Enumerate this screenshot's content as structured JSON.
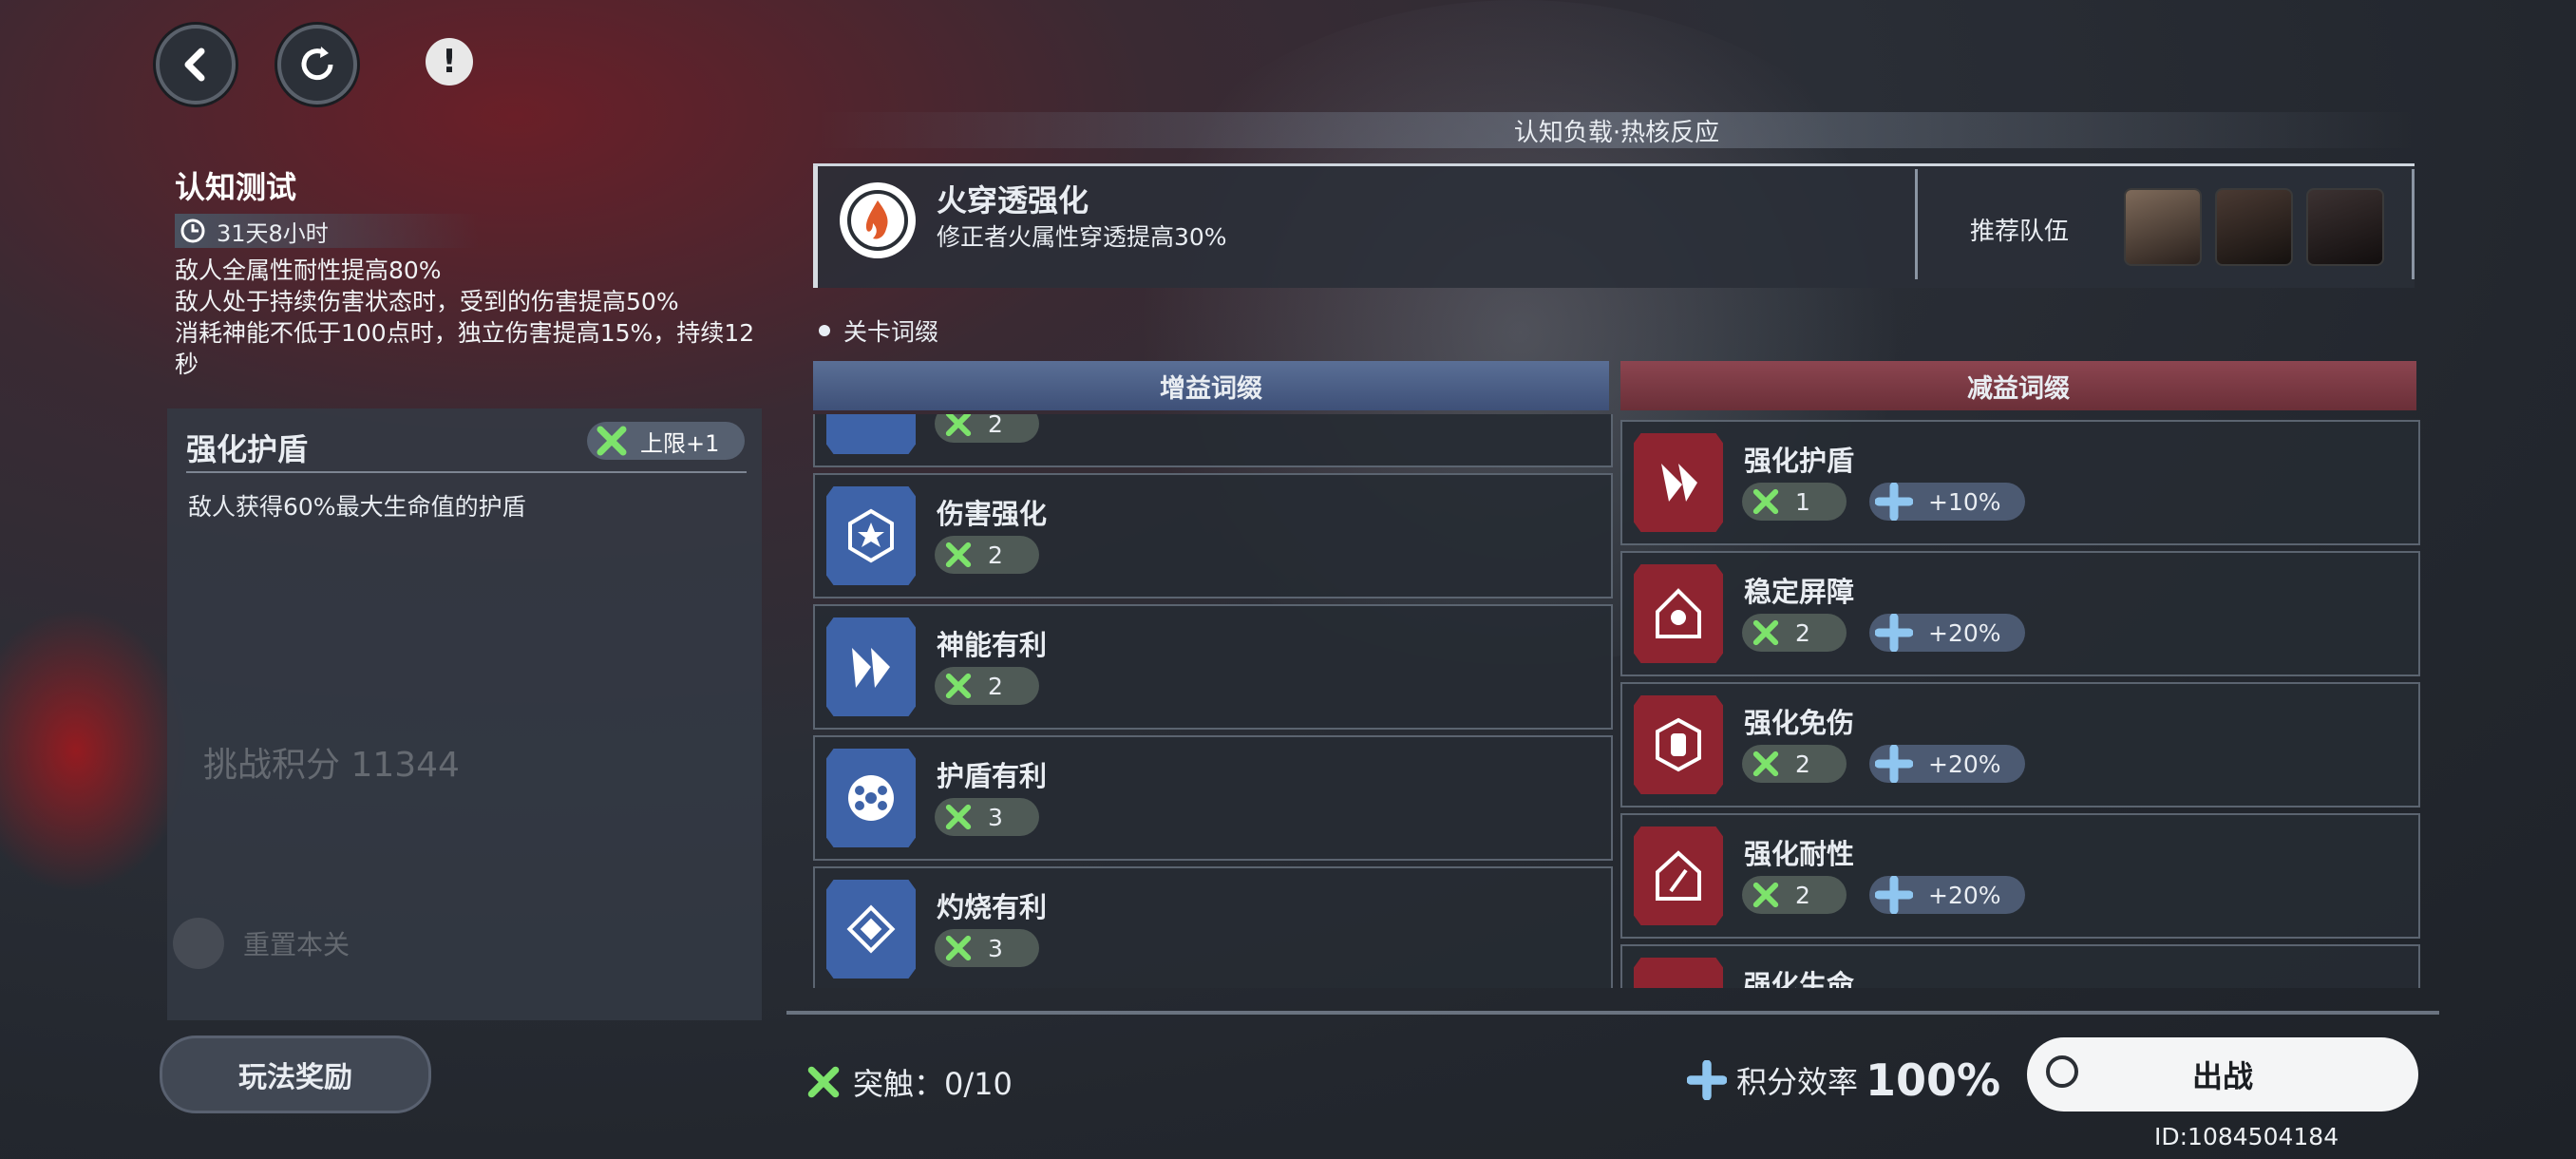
{
  "header": {
    "back_icon": "chevron-left-icon",
    "refresh_icon": "refresh-icon",
    "info_icon": "exclamation-icon",
    "info_mark": "!"
  },
  "stage": {
    "title": "认知测试",
    "time_left": "31天8小时",
    "descriptions": [
      "敌人全属性耐性提高80%",
      "敌人处于持续伤害状态时，受到的伤害提高50%",
      "消耗神能不低于100点时，独立伤害提高15%，持续12秒"
    ]
  },
  "selected_card": {
    "title": "强化护盾",
    "limit": "上限+1",
    "desc": "敌人获得60%最大生命值的护盾",
    "score_ghost": "挑战积分 11344",
    "reset_ghost": "重置本关"
  },
  "reward_button": "玩法奖励",
  "band_title": "认知负载·热核反应",
  "core_effect": {
    "title": "火穿透强化",
    "subtitle": "修正者火属性穿透提高30%"
  },
  "team": {
    "label": "推荐队伍"
  },
  "section_label": "关卡词缀",
  "buff_header": "增益词缀",
  "debuff_header": "减益词缀",
  "buffs": [
    {
      "name": "",
      "count": "2"
    },
    {
      "name": "伤害强化",
      "count": "2"
    },
    {
      "name": "神能有利",
      "count": "2"
    },
    {
      "name": "护盾有利",
      "count": "3"
    },
    {
      "name": "灼烧有利",
      "count": "3"
    }
  ],
  "debuffs": [
    {
      "name": "强化护盾",
      "count": "1",
      "bonus": "+10%"
    },
    {
      "name": "稳定屏障",
      "count": "2",
      "bonus": "+20%"
    },
    {
      "name": "强化免伤",
      "count": "2",
      "bonus": "+20%"
    },
    {
      "name": "强化耐性",
      "count": "2",
      "bonus": "+20%"
    },
    {
      "name": "强化生命",
      "count": "",
      "bonus": ""
    }
  ],
  "footer": {
    "touch_label": "突触：0/10",
    "efficiency_label": "积分效率",
    "efficiency_value": "100%",
    "deploy": "出战",
    "uid": "ID:1084504184"
  },
  "colors": {
    "green": "#7de36b",
    "blue_icon": "#3e63a8",
    "red_icon": "#8e2430",
    "cross_blue": "#8fc6f0"
  }
}
